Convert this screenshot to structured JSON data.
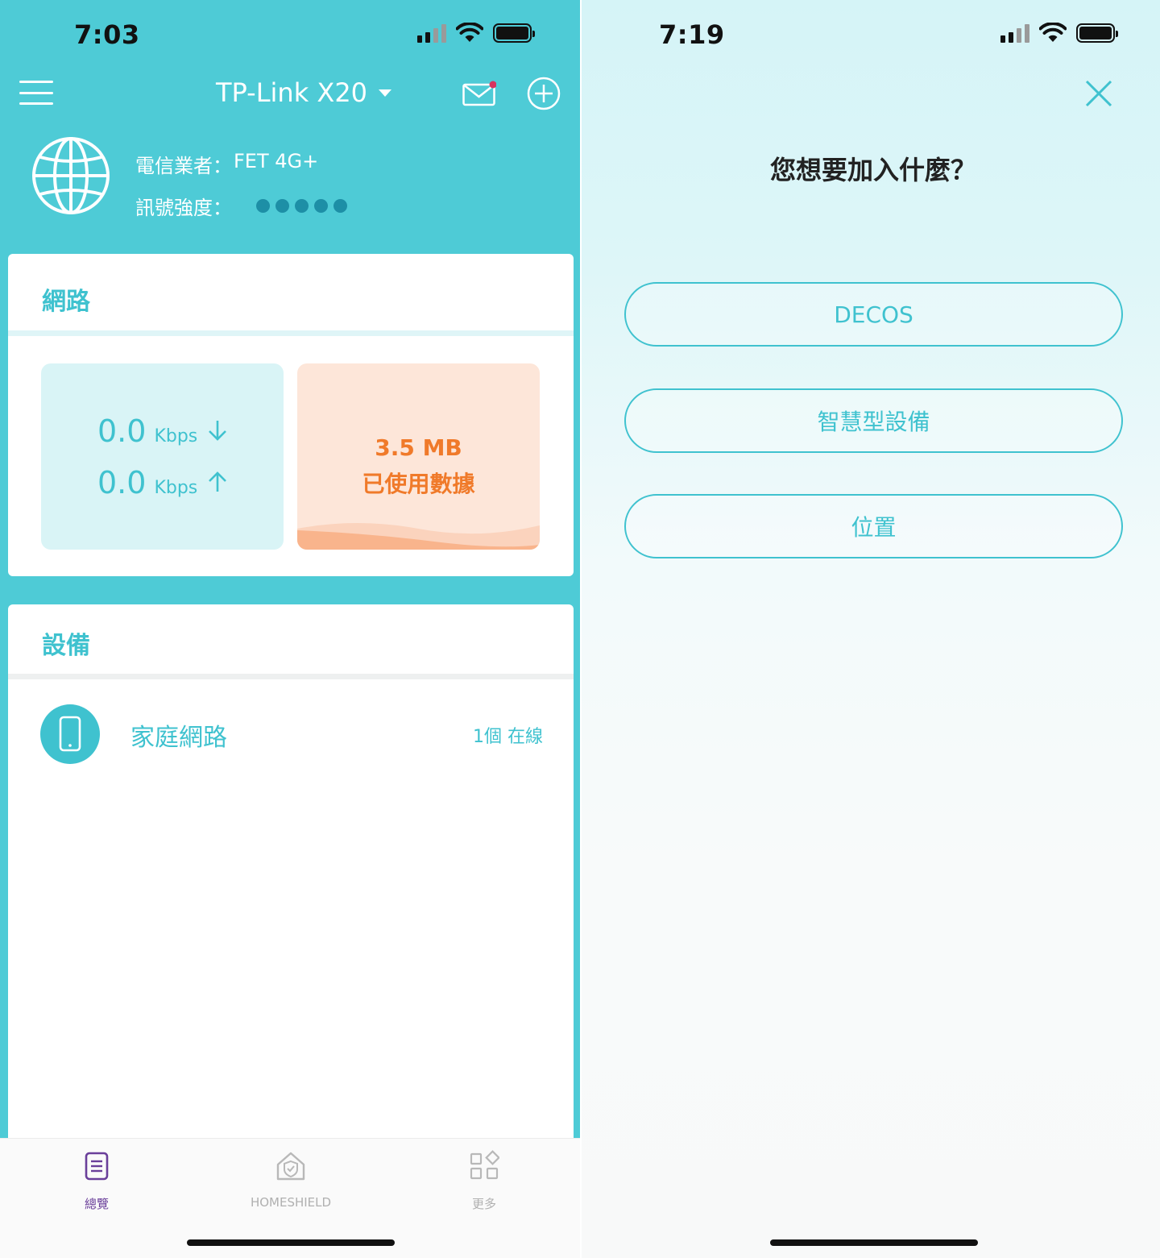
{
  "left_screen": {
    "status_bar": {
      "time": "7:03"
    },
    "header": {
      "router_name": "TP-Link X20"
    },
    "internet": {
      "carrier_label": "電信業者：",
      "carrier_value": "FET 4G+",
      "signal_label": "訊號強度：",
      "signal_dots": 5
    },
    "network_card": {
      "title": "網路",
      "download_value": "0.0",
      "download_unit": "Kbps",
      "upload_value": "0.0",
      "upload_unit": "Kbps",
      "data_used_value": "3.5 MB",
      "data_used_label": "已使用數據"
    },
    "devices_card": {
      "title": "設備",
      "group_name": "家庭網路",
      "online_count": "1個 在線"
    },
    "bottom_nav": [
      {
        "label": "總覽",
        "icon": "overview-list-icon",
        "active": true
      },
      {
        "label": "HOMESHIELD",
        "icon": "homeshield-icon",
        "active": false
      },
      {
        "label": "更多",
        "icon": "more-grid-icon",
        "active": false
      }
    ]
  },
  "right_screen": {
    "status_bar": {
      "time": "7:19"
    },
    "prompt": "您想要加入什麼？",
    "options": [
      "DECOS",
      "智慧型設備",
      "位置"
    ]
  },
  "colors": {
    "teal": "#4ecbd6",
    "accent": "#3fc2cf",
    "orange": "#f07a2a",
    "nav_active": "#6a3f9a"
  }
}
